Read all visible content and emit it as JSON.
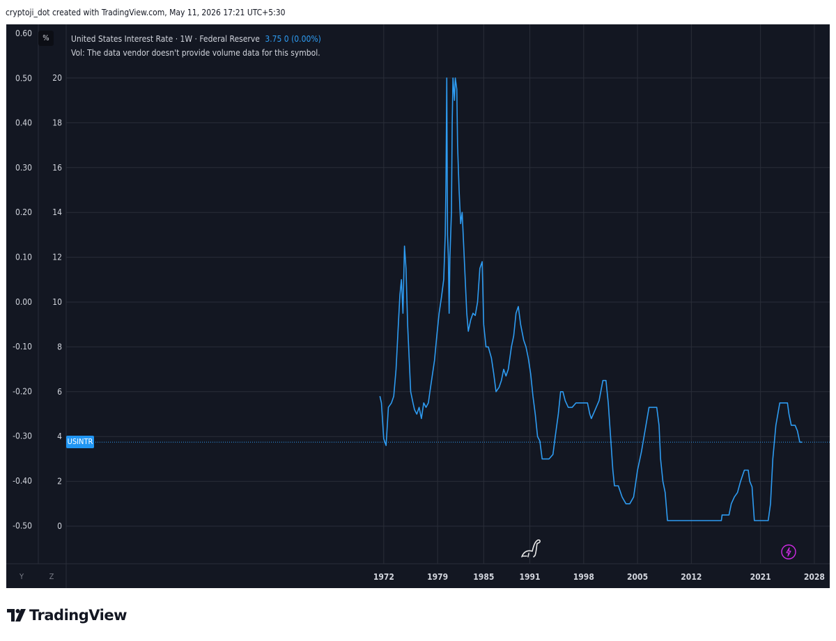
{
  "caption": "cryptoji_dot created with TradingView.com, May 11, 2026 17:21 UTC+5:30",
  "toolbar": {
    "percent_label": "%",
    "y_label": "Y",
    "z_label": "Z"
  },
  "legend": {
    "symbol_text": "United States Interest Rate · 1W · Federal Reserve",
    "value_text": "3.75  0 (0.00%)",
    "volume_text": "Vol: The data vendor doesn't provide volume data for this symbol."
  },
  "badge": {
    "label": "USINTR"
  },
  "brand": {
    "name": "TradingView"
  },
  "colors": {
    "panel": "#131722",
    "line": "#2e9cf2",
    "grid": "#2a2e39",
    "axis_text": "#d1d4dc",
    "badge": "#2196f3"
  },
  "chart_data": {
    "type": "line",
    "title": "United States Interest Rate",
    "xlabel": "",
    "ylabel": "",
    "xlim": [
      1930.7,
      2030
    ],
    "ylim": [
      -0.6,
      21.9
    ],
    "grid": true,
    "log_scale": false,
    "x_ticks": [
      "1972",
      "1979",
      "1985",
      "1991",
      "1998",
      "2005",
      "2012",
      "2021",
      "2028"
    ],
    "y_ticks_right": [
      0,
      2,
      4,
      6,
      8,
      10,
      12,
      14,
      16,
      18,
      20
    ],
    "y_ticks_left": [
      "0.60",
      "0.50",
      "0.40",
      "0.30",
      "0.20",
      "0.10",
      "0.00",
      "-0.10",
      "-0.20",
      "-0.30",
      "-0.40",
      "-0.50"
    ],
    "last_value": 3.75,
    "series": [
      {
        "name": "USINTR",
        "points": [
          [
            1971.5,
            5.8
          ],
          [
            1971.7,
            5.5
          ],
          [
            1972.0,
            3.9
          ],
          [
            1972.3,
            3.6
          ],
          [
            1972.6,
            5.3
          ],
          [
            1973.0,
            5.5
          ],
          [
            1973.3,
            5.8
          ],
          [
            1973.6,
            7.0
          ],
          [
            1973.9,
            9.0
          ],
          [
            1974.1,
            10.3
          ],
          [
            1974.3,
            11.0
          ],
          [
            1974.5,
            9.5
          ],
          [
            1974.7,
            12.5
          ],
          [
            1974.9,
            11.5
          ],
          [
            1975.1,
            9.0
          ],
          [
            1975.3,
            7.5
          ],
          [
            1975.5,
            6.0
          ],
          [
            1975.8,
            5.5
          ],
          [
            1976.0,
            5.2
          ],
          [
            1976.3,
            5.0
          ],
          [
            1976.6,
            5.3
          ],
          [
            1976.9,
            4.8
          ],
          [
            1977.2,
            5.5
          ],
          [
            1977.5,
            5.3
          ],
          [
            1977.8,
            5.5
          ],
          [
            1978.0,
            6.0
          ],
          [
            1978.3,
            6.7
          ],
          [
            1978.6,
            7.4
          ],
          [
            1978.9,
            8.5
          ],
          [
            1979.2,
            9.5
          ],
          [
            1979.5,
            10.2
          ],
          [
            1979.8,
            11.0
          ],
          [
            1980.0,
            13.0
          ],
          [
            1980.1,
            15.5
          ],
          [
            1980.2,
            20.0
          ],
          [
            1980.3,
            13.0
          ],
          [
            1980.4,
            12.0
          ],
          [
            1980.5,
            9.5
          ],
          [
            1980.6,
            12.0
          ],
          [
            1980.8,
            14.0
          ],
          [
            1980.9,
            18.0
          ],
          [
            1981.0,
            20.0
          ],
          [
            1981.2,
            19.0
          ],
          [
            1981.3,
            20.0
          ],
          [
            1981.5,
            19.5
          ],
          [
            1981.6,
            17.0
          ],
          [
            1981.8,
            15.0
          ],
          [
            1982.0,
            13.5
          ],
          [
            1982.2,
            14.0
          ],
          [
            1982.4,
            12.5
          ],
          [
            1982.6,
            11.0
          ],
          [
            1982.8,
            9.5
          ],
          [
            1983.0,
            8.7
          ],
          [
            1983.3,
            9.2
          ],
          [
            1983.6,
            9.5
          ],
          [
            1983.9,
            9.4
          ],
          [
            1984.2,
            10.0
          ],
          [
            1984.5,
            11.5
          ],
          [
            1984.8,
            11.8
          ],
          [
            1985.0,
            9.0
          ],
          [
            1985.3,
            8.0
          ],
          [
            1985.6,
            8.0
          ],
          [
            1986.0,
            7.5
          ],
          [
            1986.3,
            6.8
          ],
          [
            1986.6,
            6.0
          ],
          [
            1987.0,
            6.2
          ],
          [
            1987.3,
            6.5
          ],
          [
            1987.6,
            7.0
          ],
          [
            1987.9,
            6.7
          ],
          [
            1988.2,
            7.0
          ],
          [
            1988.6,
            8.0
          ],
          [
            1988.9,
            8.5
          ],
          [
            1989.2,
            9.5
          ],
          [
            1989.5,
            9.8
          ],
          [
            1989.8,
            9.0
          ],
          [
            1990.2,
            8.3
          ],
          [
            1990.5,
            8.0
          ],
          [
            1990.8,
            7.5
          ],
          [
            1991.1,
            6.8
          ],
          [
            1991.4,
            5.8
          ],
          [
            1991.7,
            5.0
          ],
          [
            1992.0,
            4.0
          ],
          [
            1992.3,
            3.8
          ],
          [
            1992.6,
            3.0
          ],
          [
            1993.0,
            3.0
          ],
          [
            1993.5,
            3.0
          ],
          [
            1994.0,
            3.2
          ],
          [
            1994.3,
            4.0
          ],
          [
            1994.7,
            5.0
          ],
          [
            1995.0,
            6.0
          ],
          [
            1995.3,
            6.0
          ],
          [
            1995.6,
            5.6
          ],
          [
            1996.0,
            5.3
          ],
          [
            1996.5,
            5.3
          ],
          [
            1997.0,
            5.5
          ],
          [
            1997.5,
            5.5
          ],
          [
            1998.0,
            5.5
          ],
          [
            1998.5,
            5.5
          ],
          [
            1998.8,
            5.0
          ],
          [
            1999.0,
            4.8
          ],
          [
            1999.5,
            5.2
          ],
          [
            2000.0,
            5.6
          ],
          [
            2000.5,
            6.5
          ],
          [
            2000.9,
            6.5
          ],
          [
            2001.2,
            5.5
          ],
          [
            2001.5,
            4.0
          ],
          [
            2001.8,
            2.5
          ],
          [
            2002.0,
            1.8
          ],
          [
            2002.5,
            1.8
          ],
          [
            2003.0,
            1.3
          ],
          [
            2003.5,
            1.0
          ],
          [
            2004.0,
            1.0
          ],
          [
            2004.5,
            1.3
          ],
          [
            2005.0,
            2.5
          ],
          [
            2005.5,
            3.3
          ],
          [
            2006.0,
            4.3
          ],
          [
            2006.5,
            5.3
          ],
          [
            2007.0,
            5.3
          ],
          [
            2007.5,
            5.3
          ],
          [
            2007.8,
            4.5
          ],
          [
            2008.0,
            3.0
          ],
          [
            2008.3,
            2.0
          ],
          [
            2008.6,
            1.5
          ],
          [
            2008.9,
            0.25
          ],
          [
            2010.0,
            0.25
          ],
          [
            2012.0,
            0.25
          ],
          [
            2014.0,
            0.25
          ],
          [
            2015.9,
            0.25
          ],
          [
            2016.0,
            0.5
          ],
          [
            2016.9,
            0.5
          ],
          [
            2017.2,
            1.0
          ],
          [
            2017.6,
            1.3
          ],
          [
            2018.0,
            1.5
          ],
          [
            2018.4,
            2.0
          ],
          [
            2018.9,
            2.5
          ],
          [
            2019.4,
            2.5
          ],
          [
            2019.6,
            2.0
          ],
          [
            2019.9,
            1.75
          ],
          [
            2020.2,
            0.25
          ],
          [
            2021.0,
            0.25
          ],
          [
            2022.0,
            0.25
          ],
          [
            2022.3,
            1.0
          ],
          [
            2022.6,
            3.0
          ],
          [
            2023.0,
            4.5
          ],
          [
            2023.5,
            5.5
          ],
          [
            2024.0,
            5.5
          ],
          [
            2024.5,
            5.5
          ],
          [
            2024.7,
            5.0
          ],
          [
            2025.0,
            4.5
          ],
          [
            2025.5,
            4.5
          ],
          [
            2025.8,
            4.25
          ],
          [
            2026.1,
            3.75
          ],
          [
            2026.4,
            3.75
          ]
        ]
      }
    ]
  }
}
